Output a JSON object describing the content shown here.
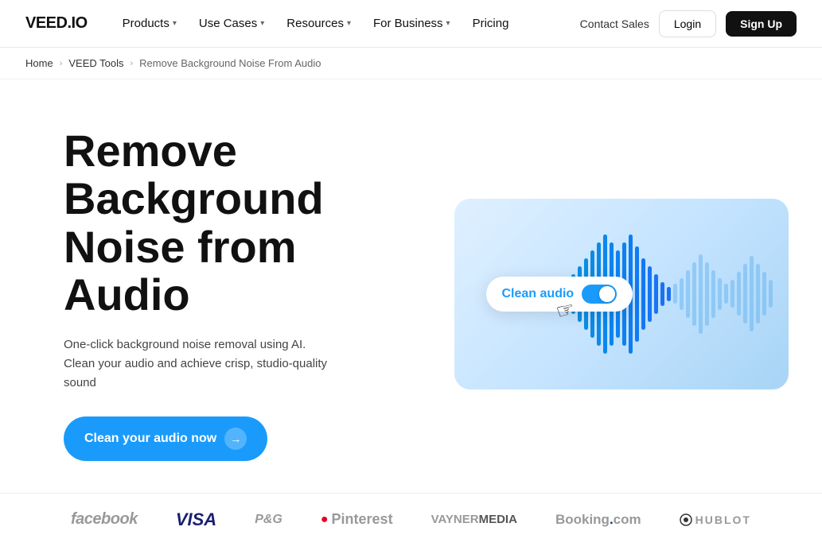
{
  "nav": {
    "logo": "VEED.IO",
    "items": [
      {
        "label": "Products",
        "has_dropdown": true
      },
      {
        "label": "Use Cases",
        "has_dropdown": true
      },
      {
        "label": "Resources",
        "has_dropdown": true
      },
      {
        "label": "For Business",
        "has_dropdown": true
      },
      {
        "label": "Pricing",
        "has_dropdown": false
      }
    ],
    "contact_sales": "Contact Sales",
    "login": "Login",
    "signup": "Sign Up"
  },
  "breadcrumb": {
    "home": "Home",
    "tools": "VEED Tools",
    "current": "Remove Background Noise From Audio"
  },
  "hero": {
    "title": "Remove Background Noise from Audio",
    "description": "One-click background noise removal using AI. Clean your audio and achieve crisp, studio-quality sound",
    "cta_button": "Clean your audio now"
  },
  "audio_card": {
    "toggle_label": "Clean audio"
  },
  "brands": [
    {
      "name": "facebook",
      "display": "facebook"
    },
    {
      "name": "visa",
      "display": "VISA"
    },
    {
      "name": "pg",
      "display": "P&G"
    },
    {
      "name": "pinterest",
      "display": "Pinterest"
    },
    {
      "name": "vaynermedia",
      "display": "VAYNERMEDIA"
    },
    {
      "name": "booking",
      "display": "Booking.com"
    },
    {
      "name": "hublot",
      "display": "HUBLOT"
    }
  ]
}
